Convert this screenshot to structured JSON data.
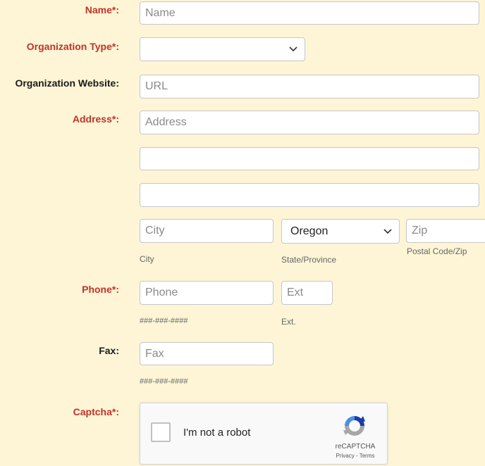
{
  "name": {
    "label": "Name*:",
    "placeholder": "Name"
  },
  "org_type": {
    "label": "Organization Type*:",
    "value": ""
  },
  "org_website": {
    "label": "Organization Website:",
    "placeholder": "URL"
  },
  "address": {
    "label": "Address*:",
    "placeholder": "Address",
    "line2": "",
    "line3": ""
  },
  "city": {
    "placeholder": "City",
    "hint": "City"
  },
  "state": {
    "value": "Oregon",
    "hint": "State/Province"
  },
  "zip": {
    "placeholder": "Zip",
    "hint": "Postal Code/Zip"
  },
  "phone": {
    "label": "Phone*:",
    "placeholder": "Phone",
    "format": "###-###-####",
    "ext_placeholder": "Ext",
    "ext_hint": "Ext."
  },
  "fax": {
    "label": "Fax:",
    "placeholder": "Fax",
    "format": "###-###-####"
  },
  "captcha": {
    "label": "Captcha*:",
    "checkbox_text": "I'm not a robot",
    "brand": "reCAPTCHA",
    "links": "Privacy - Terms"
  },
  "colors": {
    "required_label": "#c0332a",
    "page_background": "#fdf5d6"
  }
}
